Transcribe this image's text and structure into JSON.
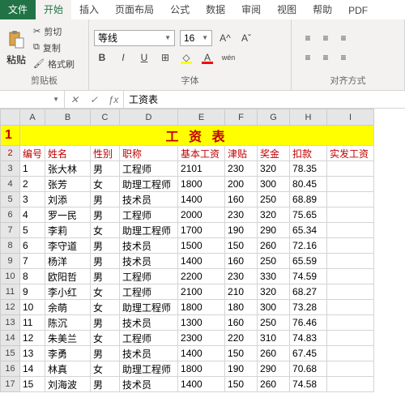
{
  "tabs": {
    "file": "文件",
    "home": "开始",
    "insert": "插入",
    "layout": "页面布局",
    "formula": "公式",
    "data": "数据",
    "review": "审阅",
    "view": "视图",
    "help": "帮助",
    "pdf": "PDF"
  },
  "ribbon": {
    "clipboard": {
      "label": "剪贴板",
      "paste": "粘贴",
      "cut": "剪切",
      "copy": "复制",
      "format_painter": "格式刷"
    },
    "font": {
      "label": "字体",
      "name": "等线",
      "size": "16"
    },
    "align": {
      "label": "对齐方式"
    }
  },
  "namebox": "",
  "formula": "工资表",
  "sheet": {
    "cols": [
      "A",
      "B",
      "C",
      "D",
      "E",
      "F",
      "G",
      "H",
      "I"
    ],
    "title": "工 资 表",
    "headers": [
      "编号",
      "姓名",
      "性别",
      "职称",
      "基本工资",
      "津贴",
      "奖金",
      "扣款",
      "实发工资"
    ],
    "rows": [
      [
        "1",
        "张大林",
        "男",
        "工程师",
        "2101",
        "230",
        "320",
        "78.35",
        ""
      ],
      [
        "2",
        "张芳",
        "女",
        "助理工程师",
        "1800",
        "200",
        "300",
        "80.45",
        ""
      ],
      [
        "3",
        "刘添",
        "男",
        "技术员",
        "1400",
        "160",
        "250",
        "68.89",
        ""
      ],
      [
        "4",
        "罗一民",
        "男",
        "工程师",
        "2000",
        "230",
        "320",
        "75.65",
        ""
      ],
      [
        "5",
        "李莉",
        "女",
        "助理工程师",
        "1700",
        "190",
        "290",
        "65.34",
        ""
      ],
      [
        "6",
        "李守道",
        "男",
        "技术员",
        "1500",
        "150",
        "260",
        "72.16",
        ""
      ],
      [
        "7",
        "杨洋",
        "男",
        "技术员",
        "1400",
        "160",
        "250",
        "65.59",
        ""
      ],
      [
        "8",
        "欧阳哲",
        "男",
        "工程师",
        "2200",
        "230",
        "330",
        "74.59",
        ""
      ],
      [
        "9",
        "李小红",
        "女",
        "工程师",
        "2100",
        "210",
        "320",
        "68.27",
        ""
      ],
      [
        "10",
        "余萌",
        "女",
        "助理工程师",
        "1800",
        "180",
        "300",
        "73.28",
        ""
      ],
      [
        "11",
        "陈沉",
        "男",
        "技术员",
        "1300",
        "160",
        "250",
        "76.46",
        ""
      ],
      [
        "12",
        "朱美兰",
        "女",
        "工程师",
        "2300",
        "220",
        "310",
        "74.83",
        ""
      ],
      [
        "13",
        "李勇",
        "男",
        "技术员",
        "1400",
        "150",
        "260",
        "67.45",
        ""
      ],
      [
        "14",
        "林真",
        "女",
        "助理工程师",
        "1800",
        "190",
        "290",
        "70.68",
        ""
      ],
      [
        "15",
        "刘海波",
        "男",
        "技术员",
        "1400",
        "150",
        "260",
        "74.58",
        ""
      ]
    ]
  }
}
